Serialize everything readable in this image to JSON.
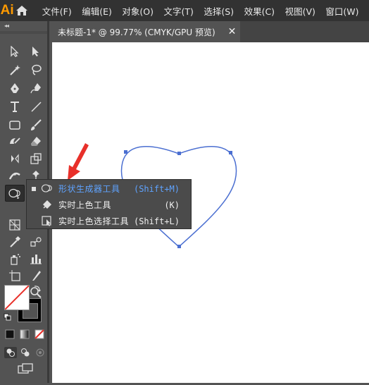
{
  "app": {
    "logo": "Ai"
  },
  "menubar": {
    "items": [
      "文件(F)",
      "编辑(E)",
      "对象(O)",
      "文字(T)",
      "选择(S)",
      "效果(C)",
      "视图(V)",
      "窗口(W)"
    ]
  },
  "toolbar": {
    "collapse_glyph": "◂◂",
    "tools": [
      "selection-tool",
      "direct-selection-tool",
      "magic-wand-tool",
      "lasso-tool",
      "pen-tool",
      "curvature-tool",
      "type-tool",
      "line-segment-tool",
      "rectangle-tool",
      "paintbrush-tool",
      "shaper-tool",
      "eraser-tool",
      "rotate-tool",
      "scale-tool",
      "width-tool",
      "puppet-warp-tool",
      "shape-builder-tool",
      "perspective-grid-tool",
      "eyedropper-tool",
      "symbol-sprayer-tool",
      "column-graph-tool",
      "artboard-tool",
      "slice-tool",
      "hand-tool",
      "zoom-tool"
    ]
  },
  "document_tab": {
    "title": "未标题-1* @ 99.77% (CMYK/GPU 预览)",
    "close": "✕"
  },
  "flyout": {
    "items": [
      {
        "label": "形状生成器工具",
        "shortcut": "(Shift+M)",
        "selected": true,
        "icon": "shape-builder-icon"
      },
      {
        "label": "实时上色工具",
        "shortcut": "(K)",
        "selected": false,
        "icon": "live-paint-bucket-icon"
      },
      {
        "label": "实时上色选择工具",
        "shortcut": "(Shift+L)",
        "selected": false,
        "icon": "live-paint-selection-icon"
      }
    ]
  },
  "colors": {
    "menubar_bg": "#323232",
    "panel_bg": "#535353",
    "canvas_bg": "#ffffff",
    "heart_stroke": "#4b6fd1",
    "highlight_text": "#5fa3ff",
    "arrow": "#e8302a"
  }
}
